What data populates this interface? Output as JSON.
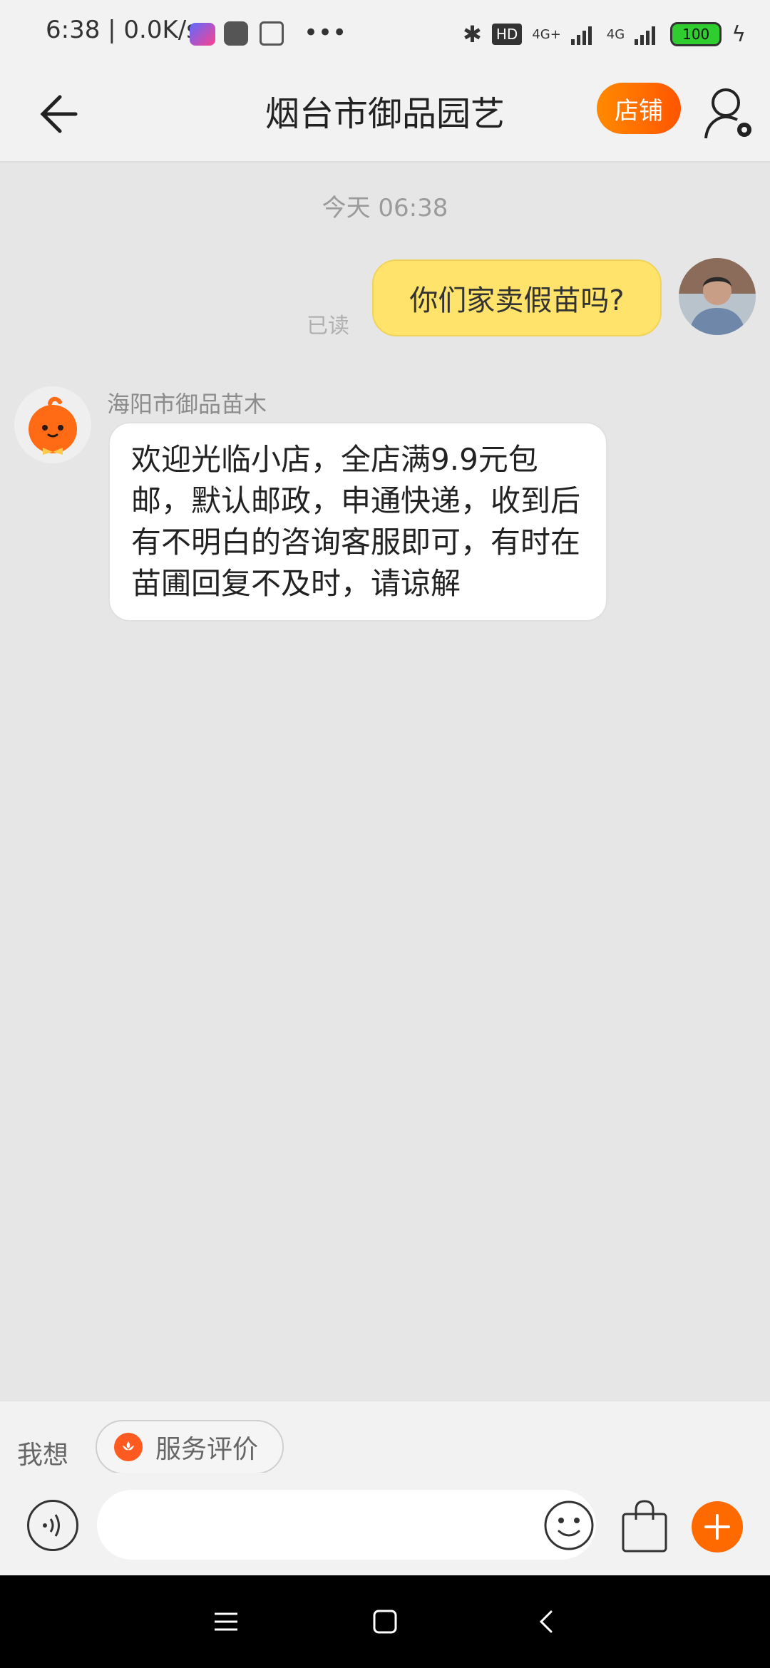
{
  "status_bar": {
    "time": "6:38 | 0.0K/s",
    "network1": "4G+",
    "network2": "4G",
    "hd": "HD",
    "battery": "100",
    "icons": [
      "app-icon",
      "mi-icon",
      "calendar-icon",
      "more-icon",
      "bluetooth-icon",
      "signal-icon",
      "battery-icon",
      "charging-icon"
    ]
  },
  "header": {
    "title": "烟台市御品园艺",
    "shop_button": "店铺",
    "back_icon": "back-arrow-icon",
    "profile_icon": "user-settings-icon"
  },
  "chat": {
    "time_divider": "今天  06:38",
    "my_message": "你们家卖假苗吗?",
    "read_status": "已读",
    "shop_sender": "海阳市御品苗木",
    "shop_message": "欢迎光临小店，全店满9.9元包邮，默认邮政，申通快递，收到后有不明白的咨询客服即可，有时在苗圃回复不及时，请谅解"
  },
  "quick_reply": {
    "label": "我想",
    "chip": "服务评价"
  },
  "input_bar": {
    "placeholder": "",
    "icons": [
      "voice-icon",
      "emoji-icon",
      "shopping-bag-icon",
      "plus-icon"
    ]
  },
  "nav": {
    "icons": [
      "menu-icon",
      "home-icon",
      "back-icon"
    ]
  },
  "colors": {
    "accent": "#ff6a00",
    "my_bubble": "#ffe36a",
    "background": "#e6e6e6"
  }
}
